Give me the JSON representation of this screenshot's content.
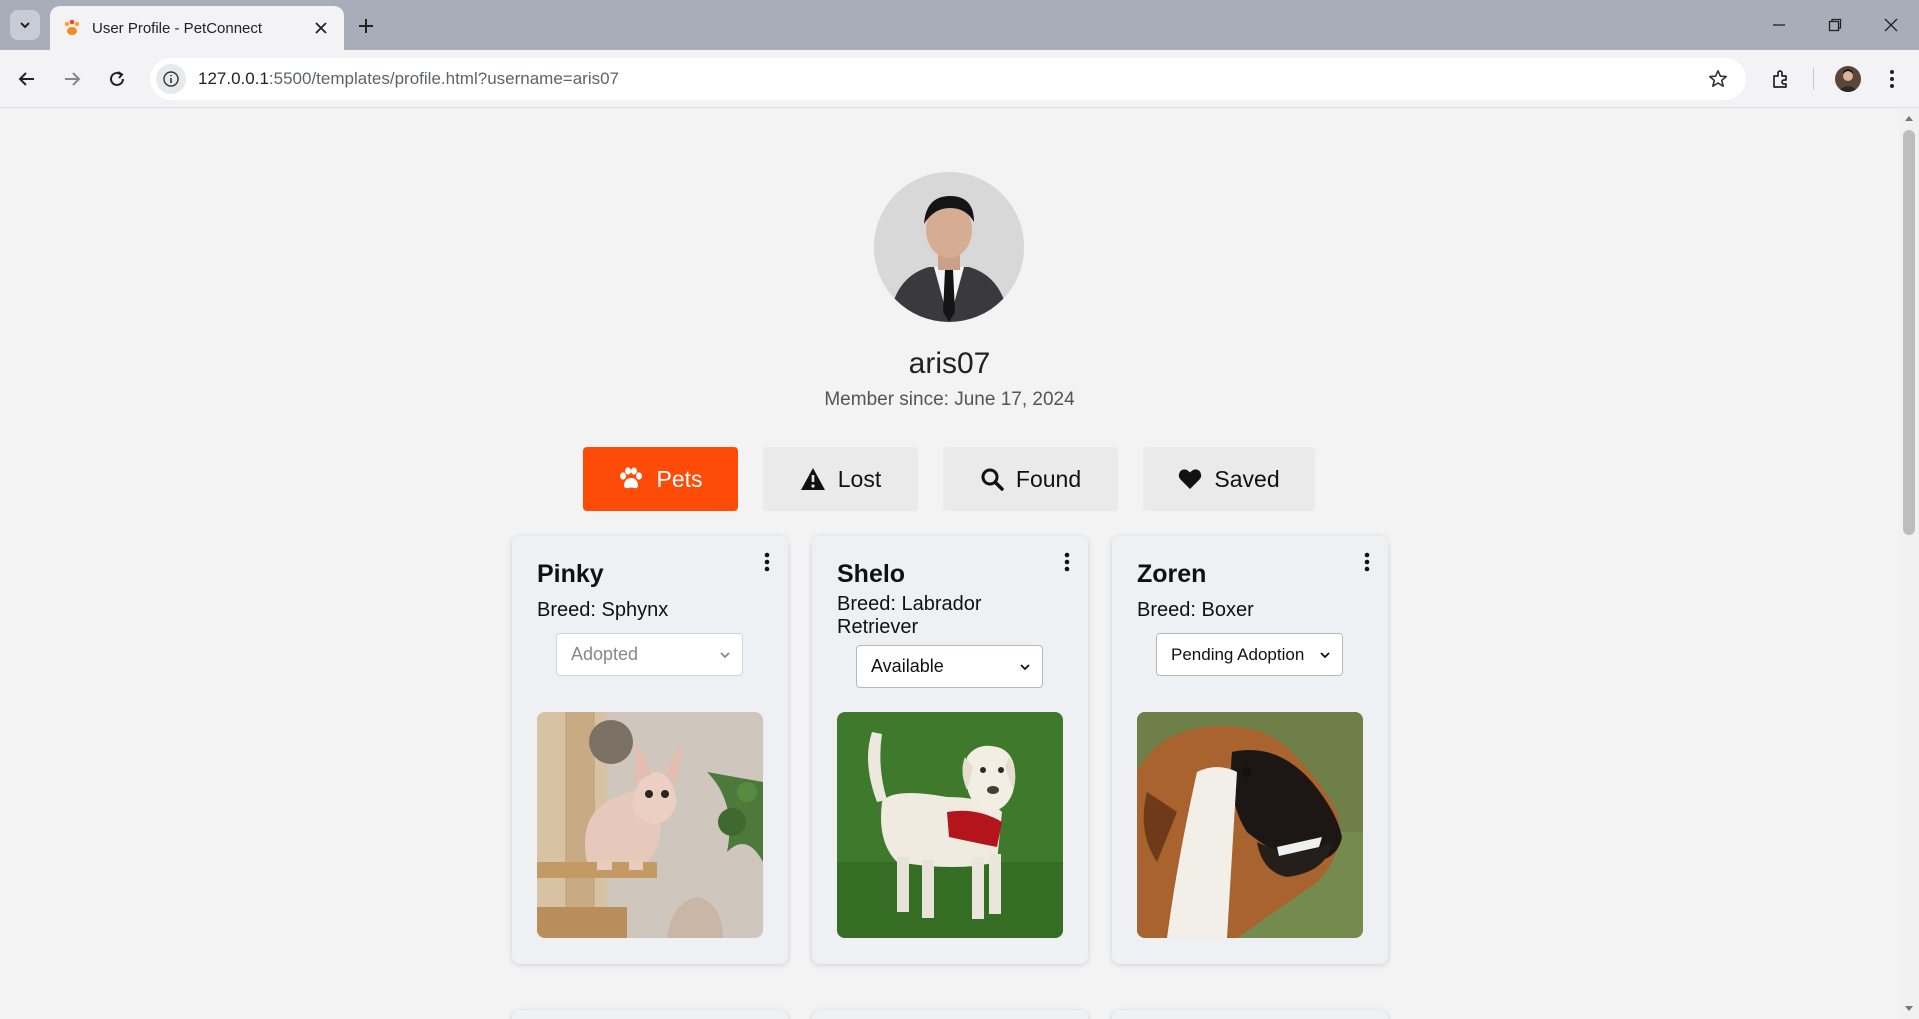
{
  "browser": {
    "tab_title": "User Profile - PetConnect",
    "url_host": "127.0.0.1",
    "url_rest": ":5500/templates/profile.html?username=aris07"
  },
  "profile": {
    "username": "aris07",
    "member_since": "Member since: June 17, 2024"
  },
  "tabs": [
    {
      "label": "Pets",
      "icon": "paw-icon",
      "active": true
    },
    {
      "label": "Lost",
      "icon": "warning-icon",
      "active": false
    },
    {
      "label": "Found",
      "icon": "search-icon",
      "active": false
    },
    {
      "label": "Saved",
      "icon": "heart-icon",
      "active": false
    }
  ],
  "pets": [
    {
      "name": "Pinky",
      "breed": "Breed: Sphynx",
      "status": "Adopted",
      "status_disabled": true
    },
    {
      "name": "Shelo",
      "breed": "Breed: Labrador Retriever",
      "status": "Available",
      "status_disabled": false
    },
    {
      "name": "Zoren",
      "breed": "Breed: Boxer",
      "status": "Pending Adoption",
      "status_disabled": false
    }
  ],
  "colors": {
    "accent": "#ff4b08",
    "page_bg": "#f3f3f3",
    "card_bg": "#eef0f3"
  }
}
